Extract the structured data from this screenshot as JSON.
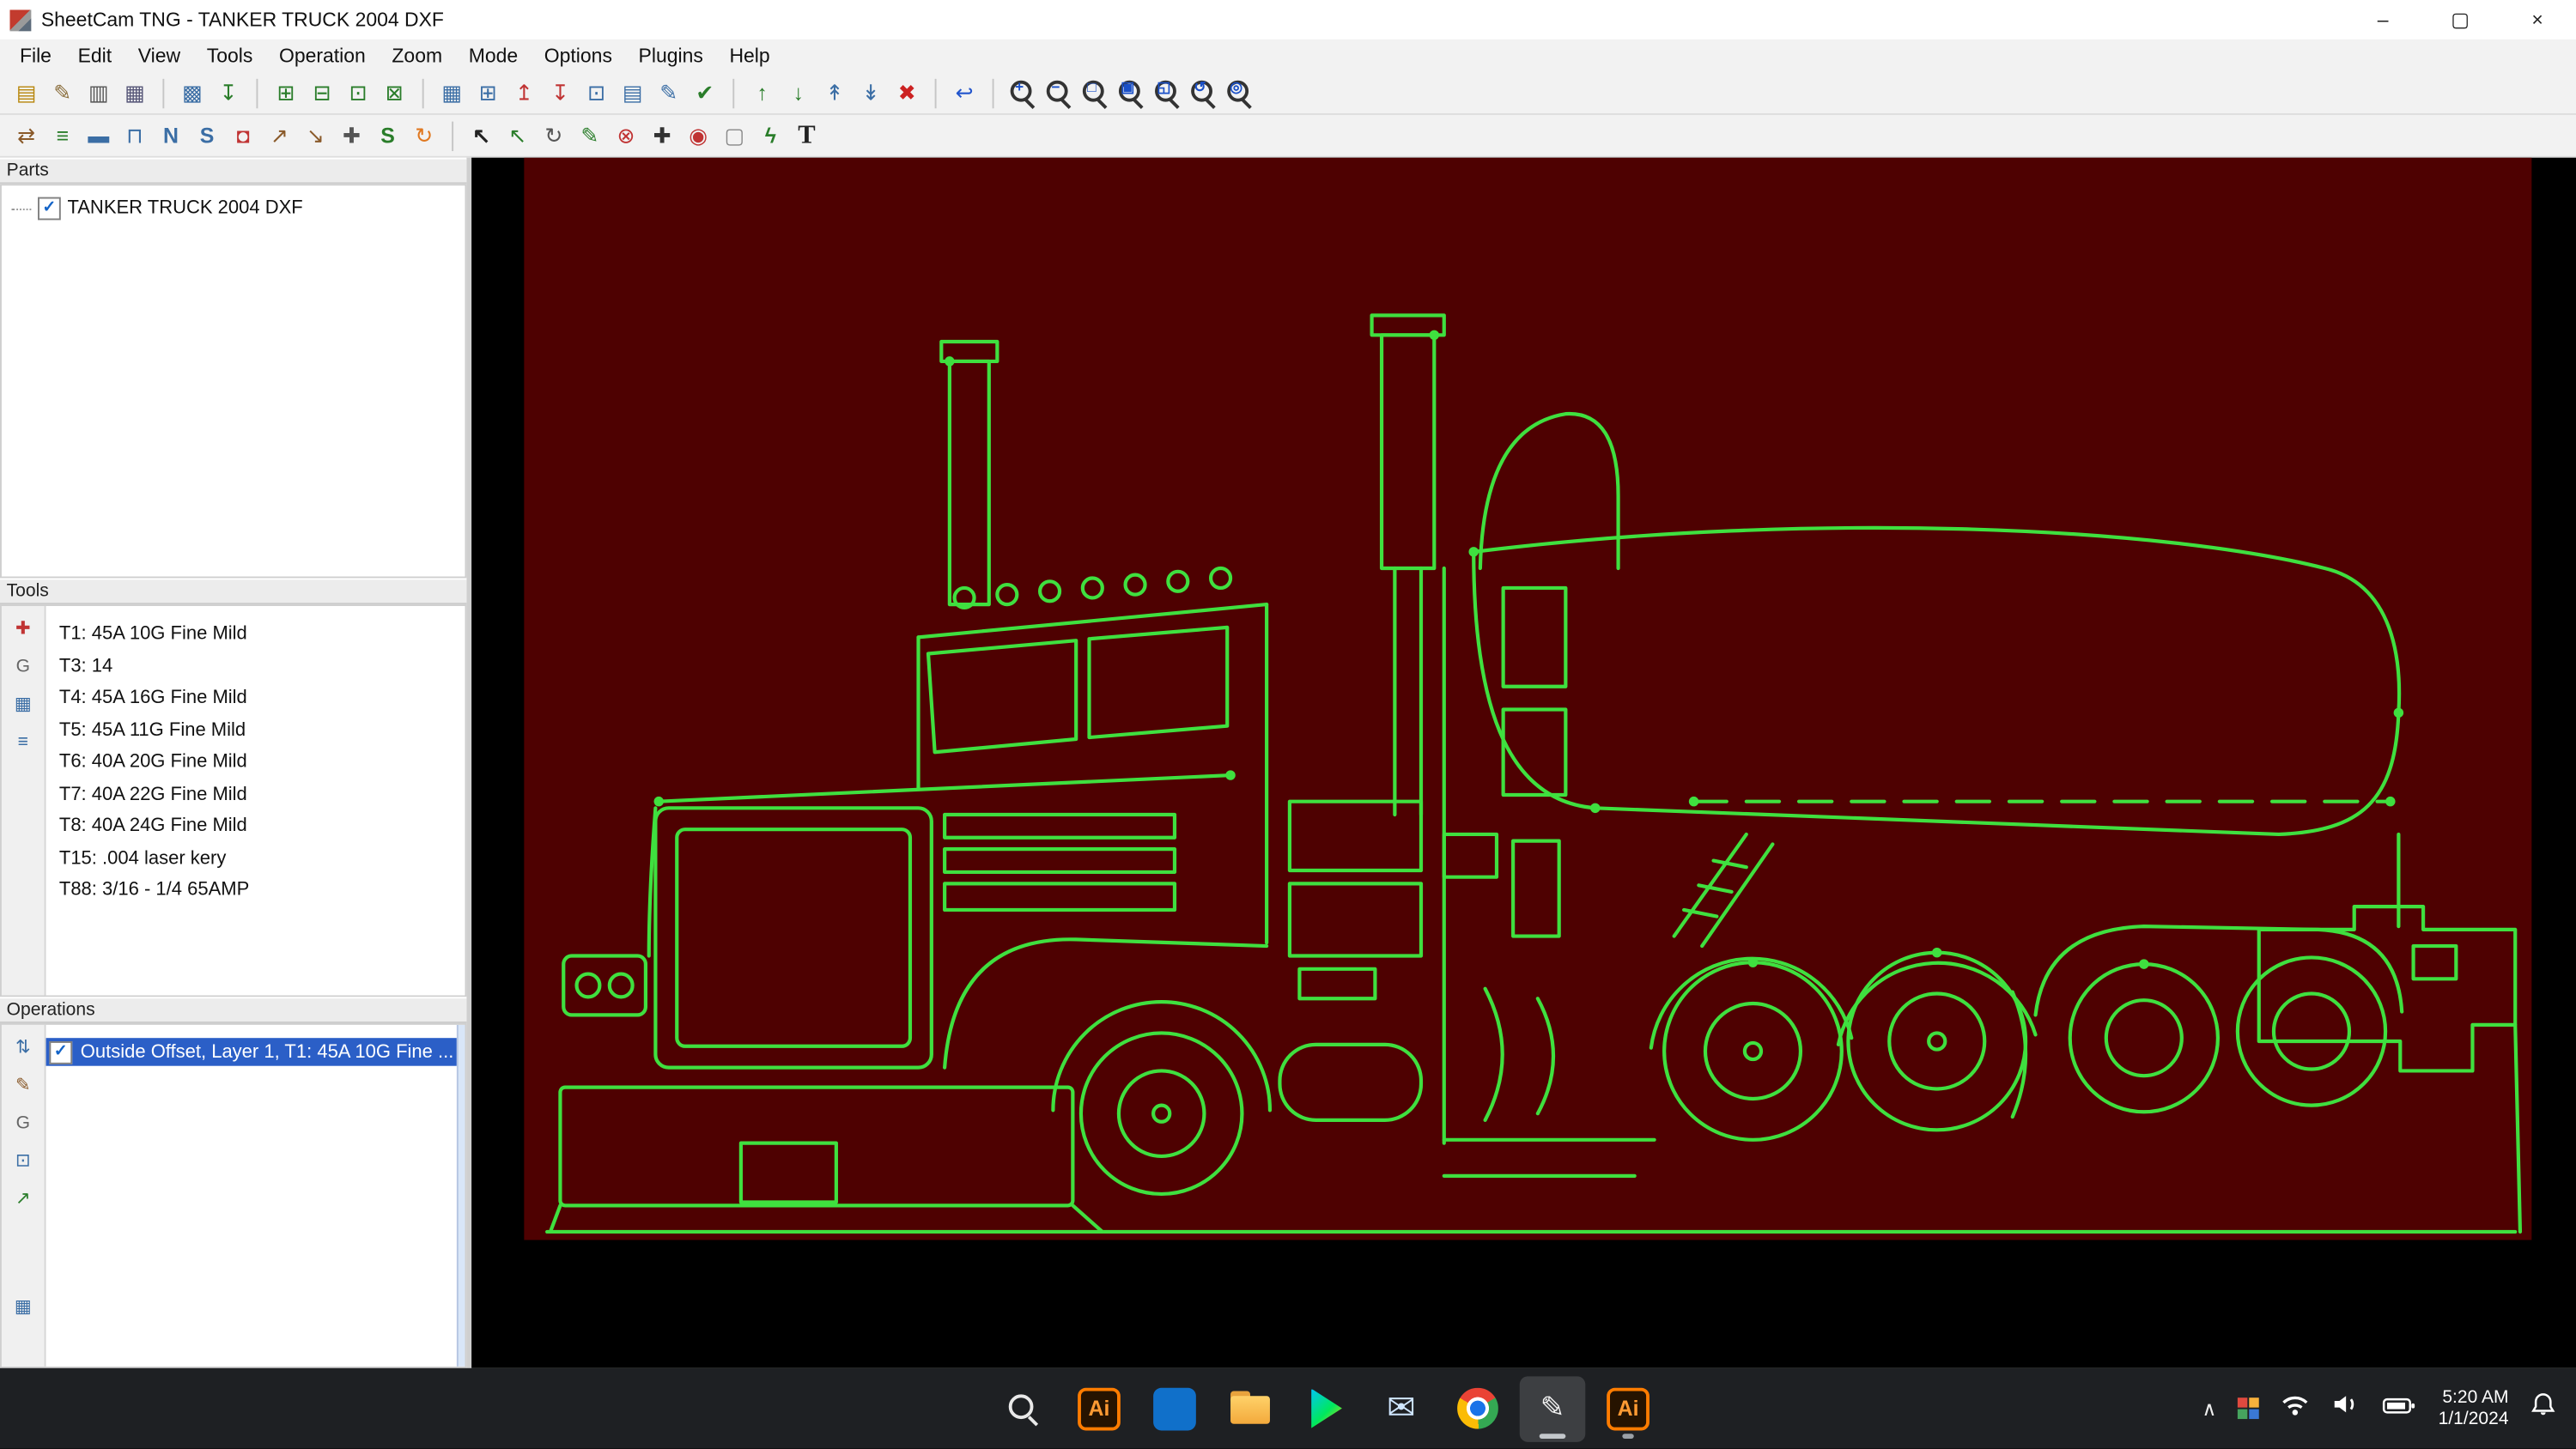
{
  "colors": {
    "accent_green": "#3fe03f",
    "plate_maroon": "#4e0101",
    "canvas_black": "#000000",
    "selection_blue": "#2b5fc7",
    "chrome_gray": "#f2f2f2",
    "taskbar_dark": "#1e2023"
  },
  "titlebar": {
    "title": "SheetCam TNG - TANKER TRUCK 2004 DXF",
    "controls": [
      {
        "name": "minimize",
        "glyph": "–"
      },
      {
        "name": "maximize",
        "glyph": "▢"
      },
      {
        "name": "close",
        "glyph": "×"
      }
    ]
  },
  "menubar": {
    "items": [
      "File",
      "Edit",
      "View",
      "Tools",
      "Operation",
      "Zoom",
      "Mode",
      "Options",
      "Plugins",
      "Help"
    ]
  },
  "toolbar_main": {
    "icons": [
      {
        "n": "open-job-icon",
        "g": "▤",
        "c": "#b8860b"
      },
      {
        "n": "job-options-icon",
        "g": "✎",
        "c": "#8a6d3b"
      },
      {
        "n": "machine-options-icon",
        "g": "▥",
        "c": "#555555"
      },
      {
        "n": "print-icon",
        "g": "▦",
        "c": "#555577"
      },
      "|",
      {
        "n": "run-post-icon",
        "g": "▩",
        "c": "#3b6ea5"
      },
      {
        "n": "post-output-icon",
        "g": "↧",
        "c": "#2a7d2a"
      },
      "|",
      {
        "n": "new-part-icon",
        "g": "⊞",
        "c": "#2a7d2a"
      },
      {
        "n": "import-part-icon",
        "g": "⊟",
        "c": "#2a7d2a"
      },
      {
        "n": "copy-part-icon",
        "g": "⊡",
        "c": "#2a7d2a"
      },
      {
        "n": "delete-part-icon",
        "g": "⊠",
        "c": "#2a7d2a"
      },
      "|",
      {
        "n": "new-operation-icon",
        "g": "▦",
        "c": "#3b6ea5"
      },
      {
        "n": "insert-operation-icon",
        "g": "⊞",
        "c": "#3b6ea5"
      },
      {
        "n": "operation-up-icon",
        "g": "↥",
        "c": "#c03333"
      },
      {
        "n": "operation-down-icon",
        "g": "↧",
        "c": "#c03333"
      },
      {
        "n": "copy-operation-icon",
        "g": "⊡",
        "c": "#3b6ea5"
      },
      {
        "n": "paste-operation-icon",
        "g": "▤",
        "c": "#3b6ea5"
      },
      {
        "n": "edit-operation-icon",
        "g": "✎",
        "c": "#3b6ea5"
      },
      {
        "n": "toggle-operation-icon",
        "g": "✔",
        "c": "#2a7d2a"
      },
      "|",
      {
        "n": "tool-up-icon",
        "g": "↑",
        "c": "#2a7d2a"
      },
      {
        "n": "tool-down-icon",
        "g": "↓",
        "c": "#2a7d2a"
      },
      {
        "n": "import-tools-icon",
        "g": "↟",
        "c": "#3b6ea5"
      },
      {
        "n": "export-tools-icon",
        "g": "↡",
        "c": "#3b6ea5"
      },
      {
        "n": "delete-icon",
        "g": "✖",
        "c": "#cc2222"
      },
      "|",
      {
        "n": "undo-icon",
        "g": "↩",
        "c": "#2255cc"
      },
      "|",
      {
        "n": "zoom-in-icon",
        "m": "+"
      },
      {
        "n": "zoom-out-icon",
        "m": "−"
      },
      {
        "n": "zoom-window-icon",
        "m": "□"
      },
      {
        "n": "zoom-part-icon",
        "m": "▣"
      },
      {
        "n": "zoom-extents-icon",
        "m": "◱"
      },
      {
        "n": "zoom-previous-icon",
        "m": "↺"
      },
      {
        "n": "zoom-all-icon",
        "m": "◎"
      }
    ]
  },
  "toolbar_edit": {
    "icons": [
      {
        "n": "toolpath-mode-icon",
        "g": "⇄",
        "c": "#8a5a2a"
      },
      {
        "n": "layers-icon",
        "g": "≡",
        "c": "#2a7d2a"
      },
      {
        "n": "material-icon",
        "g": "▬",
        "c": "#3b6ea5"
      },
      {
        "n": "contour-icon",
        "g": "⊓",
        "c": "#3b6ea5"
      },
      {
        "n": "polyline-icon",
        "g": "N",
        "c": "#3b6ea5",
        "b": 1
      },
      {
        "n": "spline-icon",
        "g": "S",
        "c": "#3b6ea5",
        "b": 1
      },
      {
        "n": "origin-icon",
        "g": "◘",
        "c": "#c03333"
      },
      {
        "n": "direction-icon",
        "g": "↗",
        "c": "#8a5a2a"
      },
      {
        "n": "reverse-icon",
        "g": "↘",
        "c": "#8a5a2a"
      },
      {
        "n": "measure-icon",
        "g": "✚",
        "c": "#555555"
      },
      {
        "n": "scale-icon",
        "g": "S",
        "c": "#2a7d2a",
        "b": 1
      },
      {
        "n": "rotate-icon",
        "g": "↻",
        "c": "#e07820"
      },
      "|",
      {
        "n": "select-icon",
        "g": "↖",
        "c": "#222222",
        "b": 1
      },
      {
        "n": "select-contour-icon",
        "g": "↖",
        "c": "#2a7d2a"
      },
      {
        "n": "rotate-view-icon",
        "g": "↻",
        "c": "#555555"
      },
      {
        "n": "edit-path-icon",
        "g": "✎",
        "c": "#2a7d2a"
      },
      {
        "n": "trim-icon",
        "g": "⊗",
        "c": "#c03333"
      },
      {
        "n": "pan-icon",
        "g": "✚",
        "c": "#333333"
      },
      {
        "n": "set-start-icon",
        "g": "◉",
        "c": "#c03333"
      },
      {
        "n": "rubber-band-icon",
        "g": "▢",
        "c": "#888888"
      },
      {
        "n": "simulate-icon",
        "g": "ϟ",
        "c": "#2a7d2a",
        "b": 1
      },
      {
        "n": "text-icon",
        "g": "T",
        "c": "#222222",
        "b": 1,
        "big": 1
      }
    ]
  },
  "parts_panel": {
    "title": "Parts",
    "items": [
      {
        "label": "TANKER TRUCK 2004 DXF",
        "checked": true
      }
    ]
  },
  "tools_panel": {
    "title": "Tools",
    "strip": [
      {
        "n": "add-tool-icon",
        "g": "✚",
        "c": "#c03333"
      },
      {
        "n": "tool-gcode-icon",
        "g": "G",
        "c": "#666666"
      },
      {
        "n": "tool-grid-icon",
        "g": "▦",
        "c": "#3b6ea5"
      },
      {
        "n": "tool-info-icon",
        "g": "≡",
        "c": "#3b6ea5"
      }
    ],
    "items": [
      "T1: 45A 10G Fine Mild",
      "T3: 14",
      "T4: 45A 16G Fine Mild",
      "T5: 45A 11G Fine Mild",
      "T6: 40A 20G Fine Mild",
      "T7: 40A 22G Fine Mild",
      "T8: 40A 24G Fine Mild",
      "T15: .004 laser kery",
      "T88: 3/16 - 1/4 65AMP"
    ]
  },
  "operations_panel": {
    "title": "Operations",
    "strip": [
      {
        "n": "op-order-icon",
        "g": "⇅",
        "c": "#3b6ea5"
      },
      {
        "n": "op-edit-icon",
        "g": "✎",
        "c": "#8a5a2a"
      },
      {
        "n": "op-gcode-icon",
        "g": "G",
        "c": "#666666"
      },
      {
        "n": "op-copy-icon",
        "g": "⊡",
        "c": "#3b6ea5"
      },
      {
        "n": "op-move-icon",
        "g": "↗",
        "c": "#2a7d2a"
      },
      "gap",
      {
        "n": "op-table-icon",
        "g": "▦",
        "c": "#3b6ea5"
      }
    ],
    "items": [
      {
        "label": "Outside Offset, Layer 1, T1: 45A 10G Fine ...",
        "checked": true,
        "selected": true
      }
    ]
  },
  "taskbar": {
    "icons": [
      {
        "name": "start",
        "kind": "start"
      },
      {
        "name": "search",
        "kind": "search"
      },
      {
        "name": "illustrator",
        "kind": "ai",
        "label": "Ai"
      },
      {
        "name": "tiles-app",
        "kind": "tiles"
      },
      {
        "name": "file-explorer",
        "kind": "folder"
      },
      {
        "name": "media-play",
        "kind": "play"
      },
      {
        "name": "mail",
        "kind": "mail",
        "glyph": "✉"
      },
      {
        "name": "chrome",
        "kind": "chrome"
      },
      {
        "name": "sheetcam-pen-app",
        "kind": "pen",
        "glyph": "✎",
        "active": true
      },
      {
        "name": "illustrator-2",
        "kind": "ai",
        "label": "Ai",
        "running": true
      }
    ],
    "tray": {
      "chevron": "∧",
      "clock": {
        "time": "5:20 AM",
        "date": "1/1/2024"
      }
    }
  }
}
